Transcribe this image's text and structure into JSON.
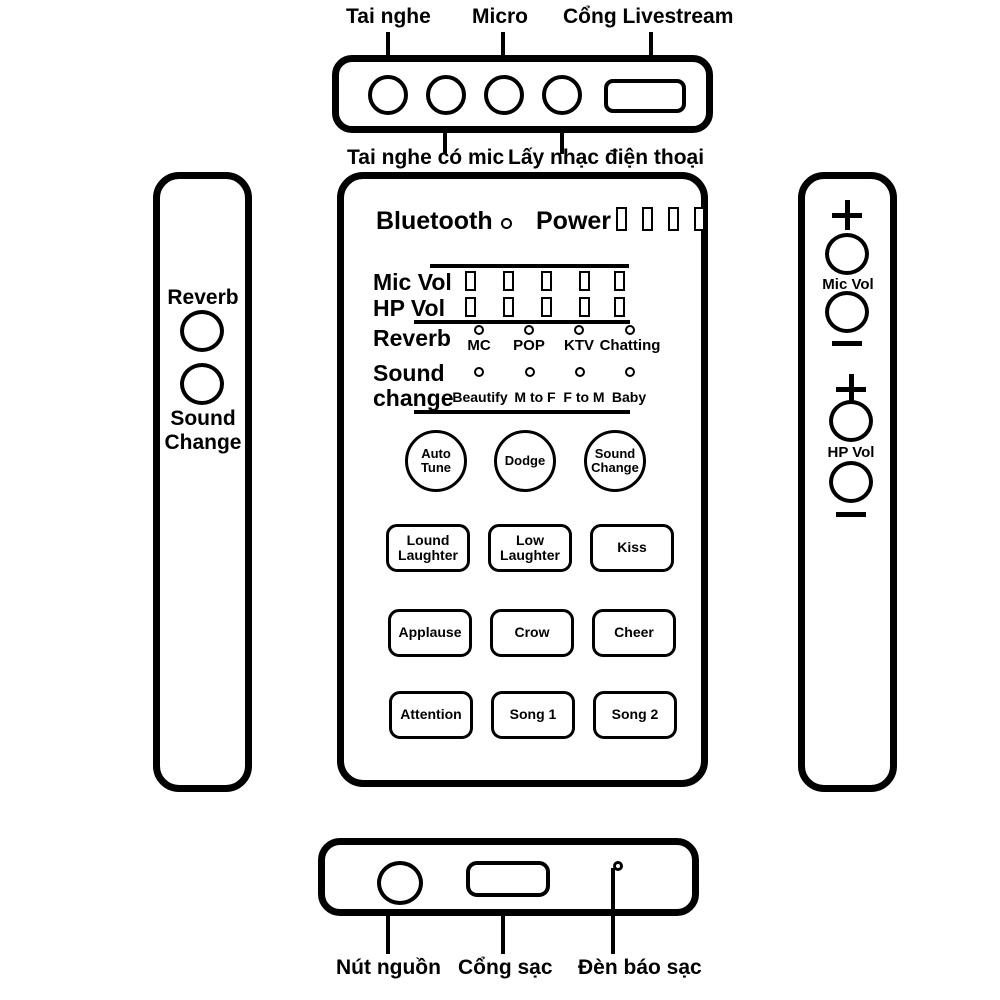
{
  "diagram": {
    "title": "Sound card device diagram — port and control callouts",
    "stroke_color": "#000000",
    "background_color": "#ffffff"
  },
  "top_panel": {
    "ports": [
      {
        "name": "headphone-jack",
        "shape": "circle"
      },
      {
        "name": "headset-mic-jack",
        "shape": "circle"
      },
      {
        "name": "microphone-jack",
        "shape": "circle"
      },
      {
        "name": "phone-audio-jack",
        "shape": "circle"
      },
      {
        "name": "livestream-port",
        "shape": "slot"
      }
    ],
    "labels_above": [
      {
        "text": "Tai nghe",
        "target": "headphone-jack"
      },
      {
        "text": "Micro",
        "target": "microphone-jack"
      },
      {
        "text": "Cổng Livestream",
        "target": "livestream-port"
      }
    ],
    "labels_below": [
      {
        "text": "Tai nghe có mic",
        "target": "headset-mic-jack"
      },
      {
        "text": "Lấy nhạc điện thoại",
        "target": "phone-audio-jack"
      }
    ]
  },
  "left_panel": {
    "buttons": [
      {
        "label": "Reverb",
        "name": "reverb-button"
      },
      {
        "label": "Sound\nChange",
        "name": "sound-change-button"
      }
    ],
    "reverb_label": "Reverb",
    "sound_change_label_line1": "Sound",
    "sound_change_label_line2": "Change"
  },
  "right_panel": {
    "groups": [
      {
        "name": "mic-volume",
        "label": "Mic Vol",
        "plus": "+",
        "minus": "−"
      },
      {
        "name": "hp-volume",
        "label": "HP Vol",
        "plus": "+",
        "minus": "−"
      }
    ]
  },
  "main_panel": {
    "bluetooth_label": "Bluetooth",
    "power_label": "Power",
    "power_indicator_count": 4,
    "mic_vol": {
      "label": "Mic Vol",
      "indicator_count": 5
    },
    "hp_vol": {
      "label": "HP Vol",
      "indicator_count": 5
    },
    "reverb": {
      "label": "Reverb",
      "options": [
        "MC",
        "POP",
        "KTV",
        "Chatting"
      ]
    },
    "sound_change": {
      "label_line1": "Sound",
      "label_line2": "change",
      "options": [
        "Beautify",
        "M to F",
        "F to M",
        "Baby"
      ]
    },
    "round_buttons": [
      {
        "line1": "Auto",
        "line2": "Tune",
        "name": "auto-tune-button"
      },
      {
        "line1": "Dodge",
        "line2": "",
        "name": "dodge-button"
      },
      {
        "line1": "Sound",
        "line2": "Change",
        "name": "sound-change-round-button"
      }
    ],
    "effect_rows": [
      [
        {
          "line1": "Lound",
          "line2": "Laughter",
          "name": "loud-laughter-button"
        },
        {
          "line1": "Low",
          "line2": "Laughter",
          "name": "low-laughter-button"
        },
        {
          "line1": "Kiss",
          "line2": "",
          "name": "kiss-button"
        }
      ],
      [
        {
          "line1": "Applause",
          "line2": "",
          "name": "applause-button"
        },
        {
          "line1": "Crow",
          "line2": "",
          "name": "crow-button"
        },
        {
          "line1": "Cheer",
          "line2": "",
          "name": "cheer-button"
        }
      ],
      [
        {
          "line1": "Attention",
          "line2": "",
          "name": "attention-button"
        },
        {
          "line1": "Song 1",
          "line2": "",
          "name": "song-1-button"
        },
        {
          "line1": "Song 2",
          "line2": "",
          "name": "song-2-button"
        }
      ]
    ]
  },
  "bottom_panel": {
    "items": [
      {
        "name": "power-button",
        "shape": "circle",
        "label": "Nút nguồn"
      },
      {
        "name": "charging-port",
        "shape": "slot",
        "label": "Cổng sạc"
      },
      {
        "name": "charge-led",
        "shape": "dot",
        "label": "Đèn báo sạc"
      }
    ]
  }
}
